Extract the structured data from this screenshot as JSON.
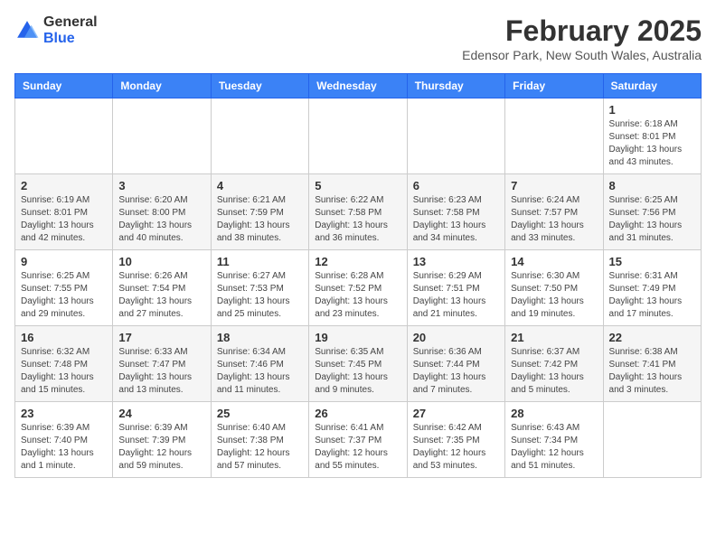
{
  "header": {
    "logo_general": "General",
    "logo_blue": "Blue",
    "month_title": "February 2025",
    "location": "Edensor Park, New South Wales, Australia"
  },
  "calendar": {
    "days_of_week": [
      "Sunday",
      "Monday",
      "Tuesday",
      "Wednesday",
      "Thursday",
      "Friday",
      "Saturday"
    ],
    "weeks": [
      [
        {
          "day": "",
          "info": ""
        },
        {
          "day": "",
          "info": ""
        },
        {
          "day": "",
          "info": ""
        },
        {
          "day": "",
          "info": ""
        },
        {
          "day": "",
          "info": ""
        },
        {
          "day": "",
          "info": ""
        },
        {
          "day": "1",
          "info": "Sunrise: 6:18 AM\nSunset: 8:01 PM\nDaylight: 13 hours\nand 43 minutes."
        }
      ],
      [
        {
          "day": "2",
          "info": "Sunrise: 6:19 AM\nSunset: 8:01 PM\nDaylight: 13 hours\nand 42 minutes."
        },
        {
          "day": "3",
          "info": "Sunrise: 6:20 AM\nSunset: 8:00 PM\nDaylight: 13 hours\nand 40 minutes."
        },
        {
          "day": "4",
          "info": "Sunrise: 6:21 AM\nSunset: 7:59 PM\nDaylight: 13 hours\nand 38 minutes."
        },
        {
          "day": "5",
          "info": "Sunrise: 6:22 AM\nSunset: 7:58 PM\nDaylight: 13 hours\nand 36 minutes."
        },
        {
          "day": "6",
          "info": "Sunrise: 6:23 AM\nSunset: 7:58 PM\nDaylight: 13 hours\nand 34 minutes."
        },
        {
          "day": "7",
          "info": "Sunrise: 6:24 AM\nSunset: 7:57 PM\nDaylight: 13 hours\nand 33 minutes."
        },
        {
          "day": "8",
          "info": "Sunrise: 6:25 AM\nSunset: 7:56 PM\nDaylight: 13 hours\nand 31 minutes."
        }
      ],
      [
        {
          "day": "9",
          "info": "Sunrise: 6:25 AM\nSunset: 7:55 PM\nDaylight: 13 hours\nand 29 minutes."
        },
        {
          "day": "10",
          "info": "Sunrise: 6:26 AM\nSunset: 7:54 PM\nDaylight: 13 hours\nand 27 minutes."
        },
        {
          "day": "11",
          "info": "Sunrise: 6:27 AM\nSunset: 7:53 PM\nDaylight: 13 hours\nand 25 minutes."
        },
        {
          "day": "12",
          "info": "Sunrise: 6:28 AM\nSunset: 7:52 PM\nDaylight: 13 hours\nand 23 minutes."
        },
        {
          "day": "13",
          "info": "Sunrise: 6:29 AM\nSunset: 7:51 PM\nDaylight: 13 hours\nand 21 minutes."
        },
        {
          "day": "14",
          "info": "Sunrise: 6:30 AM\nSunset: 7:50 PM\nDaylight: 13 hours\nand 19 minutes."
        },
        {
          "day": "15",
          "info": "Sunrise: 6:31 AM\nSunset: 7:49 PM\nDaylight: 13 hours\nand 17 minutes."
        }
      ],
      [
        {
          "day": "16",
          "info": "Sunrise: 6:32 AM\nSunset: 7:48 PM\nDaylight: 13 hours\nand 15 minutes."
        },
        {
          "day": "17",
          "info": "Sunrise: 6:33 AM\nSunset: 7:47 PM\nDaylight: 13 hours\nand 13 minutes."
        },
        {
          "day": "18",
          "info": "Sunrise: 6:34 AM\nSunset: 7:46 PM\nDaylight: 13 hours\nand 11 minutes."
        },
        {
          "day": "19",
          "info": "Sunrise: 6:35 AM\nSunset: 7:45 PM\nDaylight: 13 hours\nand 9 minutes."
        },
        {
          "day": "20",
          "info": "Sunrise: 6:36 AM\nSunset: 7:44 PM\nDaylight: 13 hours\nand 7 minutes."
        },
        {
          "day": "21",
          "info": "Sunrise: 6:37 AM\nSunset: 7:42 PM\nDaylight: 13 hours\nand 5 minutes."
        },
        {
          "day": "22",
          "info": "Sunrise: 6:38 AM\nSunset: 7:41 PM\nDaylight: 13 hours\nand 3 minutes."
        }
      ],
      [
        {
          "day": "23",
          "info": "Sunrise: 6:39 AM\nSunset: 7:40 PM\nDaylight: 13 hours\nand 1 minute."
        },
        {
          "day": "24",
          "info": "Sunrise: 6:39 AM\nSunset: 7:39 PM\nDaylight: 12 hours\nand 59 minutes."
        },
        {
          "day": "25",
          "info": "Sunrise: 6:40 AM\nSunset: 7:38 PM\nDaylight: 12 hours\nand 57 minutes."
        },
        {
          "day": "26",
          "info": "Sunrise: 6:41 AM\nSunset: 7:37 PM\nDaylight: 12 hours\nand 55 minutes."
        },
        {
          "day": "27",
          "info": "Sunrise: 6:42 AM\nSunset: 7:35 PM\nDaylight: 12 hours\nand 53 minutes."
        },
        {
          "day": "28",
          "info": "Sunrise: 6:43 AM\nSunset: 7:34 PM\nDaylight: 12 hours\nand 51 minutes."
        },
        {
          "day": "",
          "info": ""
        }
      ]
    ]
  }
}
